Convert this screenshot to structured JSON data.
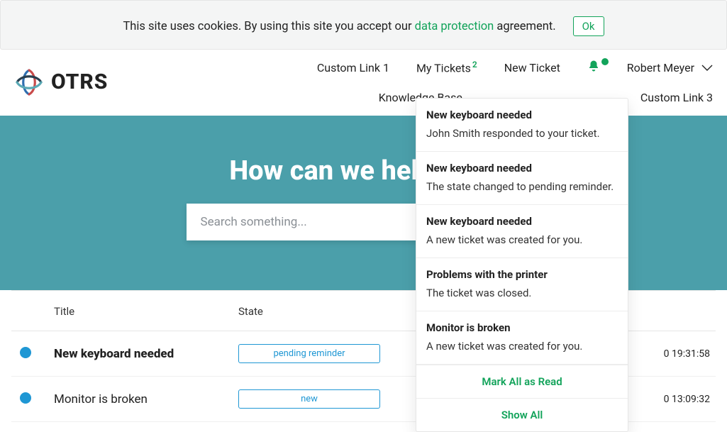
{
  "cookie": {
    "prefix": "This site uses cookies. By using this site you accept our ",
    "link": "data protection",
    "suffix": " agreement.",
    "ok": "Ok"
  },
  "brand": {
    "name": "OTRS"
  },
  "nav": {
    "custom1": "Custom Link 1",
    "mytickets": "My Tickets",
    "mytickets_badge": "2",
    "newticket": "New Ticket",
    "user": "Robert Meyer",
    "knowledge": "Knowledge Base",
    "custom3": "Custom Link 3"
  },
  "hero": {
    "title": "How can we help you?",
    "placeholder": "Search something..."
  },
  "notifications": [
    {
      "title": "New keyboard needed",
      "body": "John Smith responded to your ticket."
    },
    {
      "title": "New keyboard needed",
      "body": "The state changed to pending reminder."
    },
    {
      "title": "New keyboard needed",
      "body": "A new ticket was created for you."
    },
    {
      "title": "Problems with the printer",
      "body": "The ticket was closed."
    },
    {
      "title": "Monitor is broken",
      "body": "A new ticket was created for you."
    }
  ],
  "notif_actions": {
    "mark_all": "Mark All as Read",
    "show_all": "Show All"
  },
  "table": {
    "headers": {
      "title": "Title",
      "state": "State"
    },
    "rows": [
      {
        "title": "New keyboard needed",
        "bold": true,
        "state": "pending reminder",
        "time": "0 19:31:58"
      },
      {
        "title": "Monitor is broken",
        "bold": false,
        "state": "new",
        "time": "0 13:09:32"
      }
    ]
  }
}
